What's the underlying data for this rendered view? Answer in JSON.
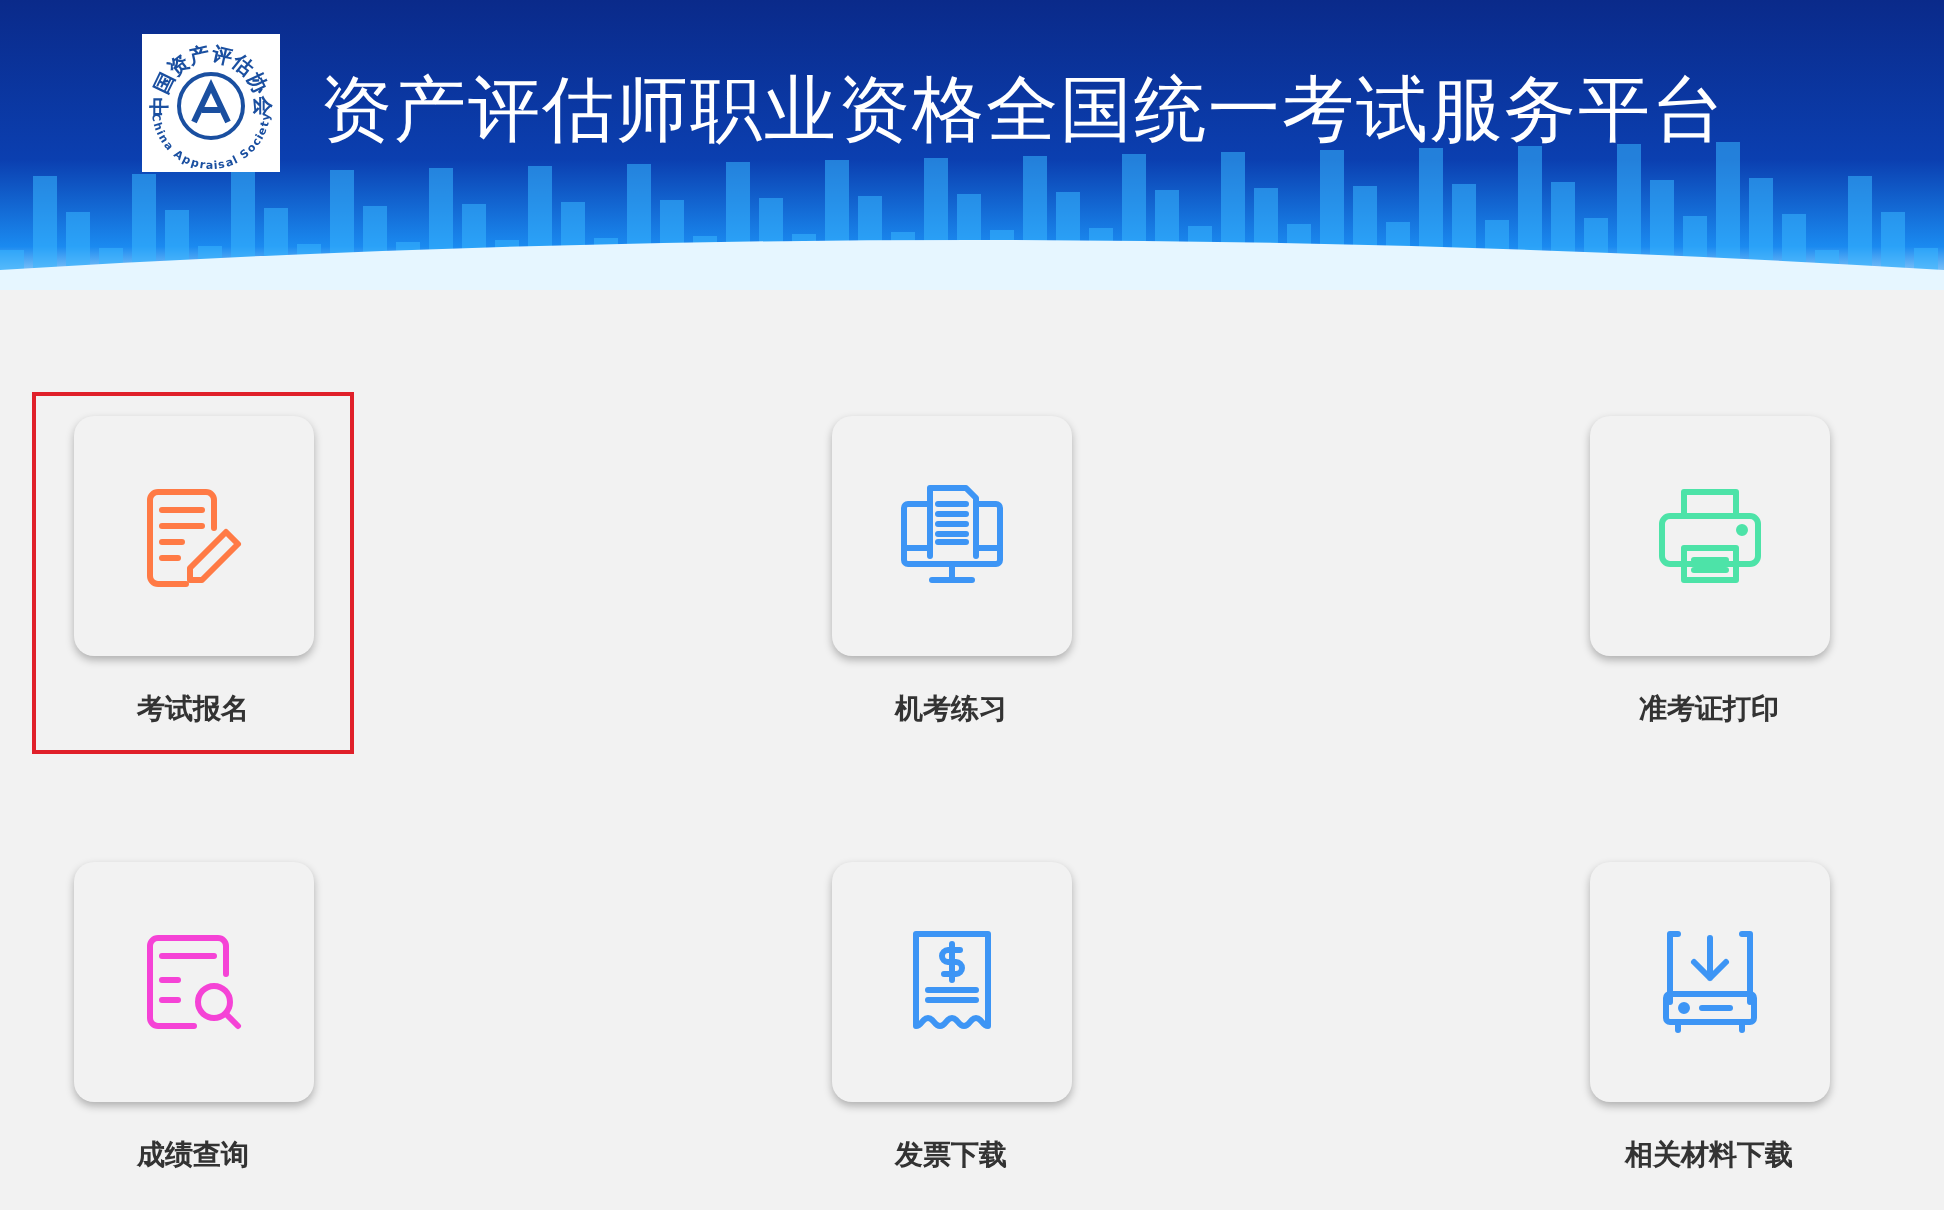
{
  "header": {
    "title": "资产评估师职业资格全国统一考试服务平台",
    "logo": {
      "top_text": "中国资产评估协会",
      "bottom_text": "China Appraisal Society"
    }
  },
  "services": [
    {
      "label": "考试报名",
      "kind": "edit",
      "color": "#ff7a45",
      "selected": true
    },
    {
      "label": "机考练习",
      "kind": "computer",
      "color": "#3d95f5",
      "selected": false
    },
    {
      "label": "准考证打印",
      "kind": "printer",
      "color": "#4de3a8",
      "selected": false
    },
    {
      "label": "成绩查询",
      "kind": "search",
      "color": "#f543d6",
      "selected": false
    },
    {
      "label": "发票下载",
      "kind": "invoice",
      "color": "#3d95f5",
      "selected": false
    },
    {
      "label": "相关材料下载",
      "kind": "download",
      "color": "#3d95f5",
      "selected": false
    }
  ]
}
